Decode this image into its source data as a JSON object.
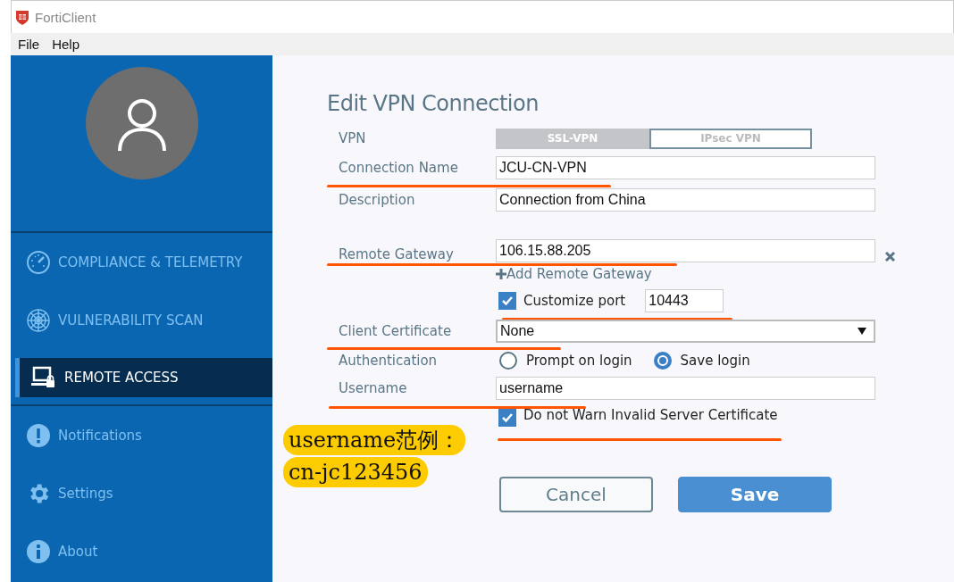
{
  "window": {
    "title": "FortiClient"
  },
  "menu": [
    "File",
    "Help"
  ],
  "sidebar": {
    "items": [
      {
        "label": "COMPLIANCE & TELEMETRY",
        "kind": "gauge",
        "selected": false
      },
      {
        "label": "VULNERABILITY SCAN",
        "kind": "radar",
        "selected": false
      },
      {
        "label": "REMOTE ACCESS",
        "kind": "laptop",
        "selected": true
      }
    ],
    "bottom_items": [
      {
        "label": "Notifications",
        "kind": "alert"
      },
      {
        "label": "Settings",
        "kind": "gear"
      },
      {
        "label": "About",
        "kind": "info"
      }
    ]
  },
  "form": {
    "title": "Edit VPN Connection",
    "vpn": {
      "label": "VPN",
      "options": [
        {
          "label": "SSL-VPN",
          "selected": true
        },
        {
          "label": "IPsec VPN",
          "selected": false
        }
      ]
    },
    "connection_name": {
      "label": "Connection Name",
      "value": "JCU-CN-VPN",
      "highlighted": true
    },
    "description": {
      "label": "Description",
      "value": "Connection from China"
    },
    "remote_gateway": {
      "label": "Remote Gateway",
      "value": "106.15.88.205",
      "highlighted": true
    },
    "add_gateway": "Add Remote Gateway",
    "customize_port": {
      "label": "Customize port",
      "checked": true,
      "value": "10443",
      "highlighted": true
    },
    "client_certificate": {
      "label": "Client Certificate",
      "value": "None",
      "highlighted": true
    },
    "authentication": {
      "label": "Authentication",
      "options": [
        {
          "label": "Prompt on login",
          "selected": false
        },
        {
          "label": "Save login",
          "selected": true
        }
      ]
    },
    "username": {
      "label": "Username",
      "value": "username",
      "highlighted": true
    },
    "no_warn": {
      "label": "Do not Warn Invalid Server Certificate",
      "checked": true,
      "highlighted": true
    },
    "buttons": [
      {
        "label": "Cancel",
        "kind": "secondary"
      },
      {
        "label": "Save",
        "kind": "primary"
      }
    ]
  },
  "note": {
    "lines": [
      "username范例：",
      "cn-jc123456"
    ]
  }
}
